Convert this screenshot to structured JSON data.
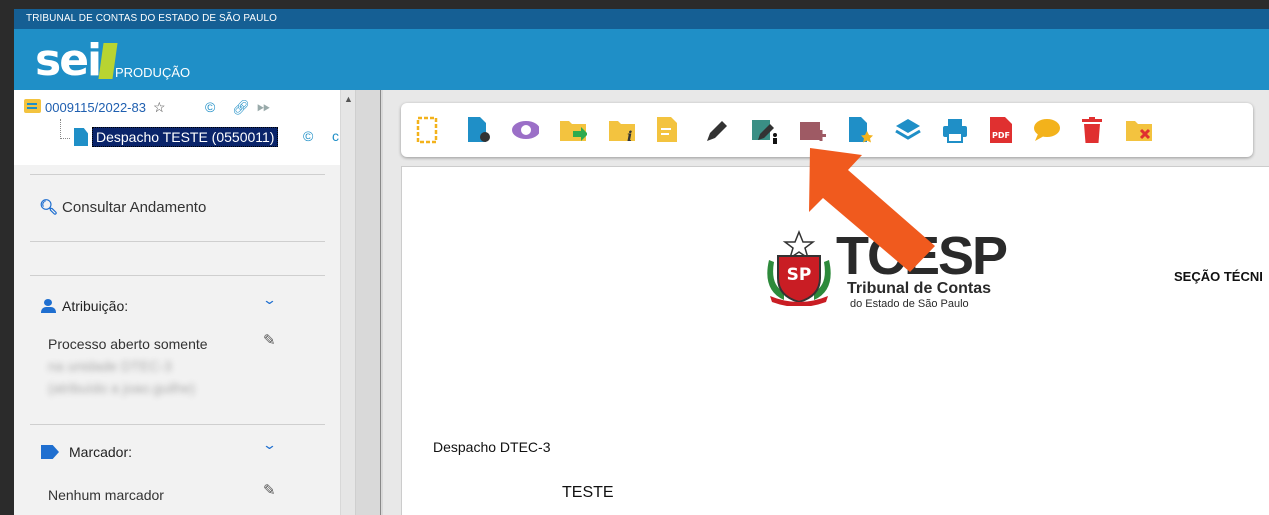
{
  "header": {
    "org": "TRIBUNAL DE CONTAS DO ESTADO DE SÃO PAULO",
    "logo_text": "sei",
    "environment": "PRODUÇÃO"
  },
  "tree": {
    "process_number": "0009115/2022-83",
    "document_label": "Despacho TESTE (0550011)"
  },
  "sidebar": {
    "consult_label": "Consultar Andamento",
    "attribution": {
      "title": "Atribuição:",
      "text_line1": "Processo aberto somente",
      "blurred_line2": "na unidade DTEC-3",
      "blurred_line3": "(atribuído a joao.guilhe)"
    },
    "marker": {
      "title": "Marcador:",
      "text": "Nenhum marcador"
    }
  },
  "toolbar": {
    "icons": [
      "new-document-icon",
      "process-settings-icon",
      "view-icon",
      "send-process-icon",
      "process-info-icon",
      "edit-document-icon",
      "sign-icon",
      "sign-block-icon",
      "add-document-icon",
      "favorite-document-icon",
      "layers-icon",
      "print-icon",
      "pdf-icon",
      "comment-icon",
      "delete-icon",
      "close-process-icon"
    ]
  },
  "document": {
    "logo_main": "TCESP",
    "logo_sub1": "Tribunal de Contas",
    "logo_sub2": "do Estado de São Paulo",
    "seal_text": "SP",
    "section": "SEÇÃO TÉCNI",
    "despacho": "Despacho DTEC-3",
    "body": "TESTE"
  },
  "colors": {
    "top_bar": "#155f94",
    "brand_bar": "#1f8fc7",
    "accent_arrow": "#f05a1e",
    "selected_item": "#0a246a"
  }
}
